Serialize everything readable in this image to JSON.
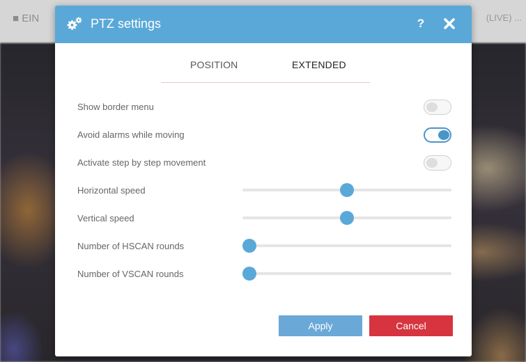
{
  "background": {
    "topbar_left": "■ EIN",
    "topbar_right": "(LIVE) ... "
  },
  "dialog": {
    "title": "PTZ settings",
    "help_icon_label": "?",
    "tabs": [
      {
        "label": "POSITION",
        "active": false
      },
      {
        "label": "EXTENDED",
        "active": true
      }
    ],
    "toggles": [
      {
        "label": "Show border menu",
        "on": false
      },
      {
        "label": "Avoid alarms while moving",
        "on": true
      },
      {
        "label": "Activate step by step movement",
        "on": false
      }
    ],
    "sliders": [
      {
        "label": "Horizontal speed",
        "value": 0.5
      },
      {
        "label": "Vertical speed",
        "value": 0.5
      },
      {
        "label": "Number of HSCAN rounds",
        "value": 0.0
      },
      {
        "label": "Number of VSCAN rounds",
        "value": 0.0
      }
    ],
    "buttons": {
      "apply": "Apply",
      "cancel": "Cancel"
    }
  },
  "colors": {
    "header": "#5aa8d8",
    "accent": "#4a95c8",
    "apply": "#6aa8d8",
    "cancel": "#d6343f"
  },
  "icons": {
    "title": "gears-icon",
    "help": "question-icon",
    "close": "close-icon"
  }
}
